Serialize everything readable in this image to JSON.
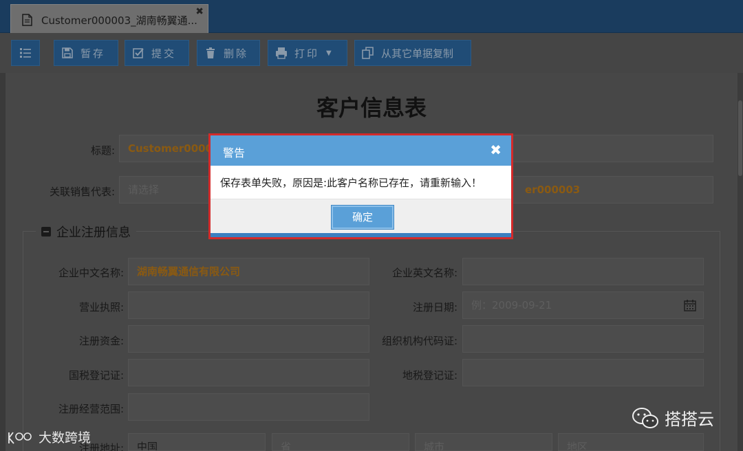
{
  "tab": {
    "label": "Customer000003_湖南畅翼通...",
    "close": "✖"
  },
  "toolbar": {
    "save": "暂存",
    "submit": "提交",
    "delete": "删除",
    "print": "打印",
    "copy": "从其它单据复制"
  },
  "form": {
    "title": "客户信息表",
    "title_label": "标题:",
    "title_value": "Customer00000",
    "sales_label": "关联销售代表:",
    "sales_placeholder": "请选择",
    "right_value": "er000003",
    "section_title": "企业注册信息",
    "fields": {
      "cn_name_label": "企业中文名称:",
      "cn_name_value": "湖南畅翼通信有限公司",
      "en_name_label": "企业英文名称:",
      "license_label": "营业执照:",
      "reg_date_label": "注册日期:",
      "reg_date_placeholder": "例：2009-09-21",
      "capital_label": "注册资金:",
      "org_code_label": "组织机构代码证:",
      "national_tax_label": "国税登记证:",
      "local_tax_label": "地税登记证:",
      "scope_label": "注册经营范围:",
      "country_value": "中国",
      "province_placeholder": "省",
      "city_placeholder": "城市",
      "district_placeholder": "地区",
      "address_label_partial": "注册地址:"
    }
  },
  "dialog": {
    "title": "警告",
    "close": "✖",
    "message": "保存表单失败，原因是:此客户名称已存在，请重新输入！",
    "ok": "确定"
  },
  "watermarks": {
    "left": "大数跨境",
    "right": "搭搭云"
  },
  "colors": {
    "accent": "#5aa0d8",
    "alert_border": "#d42a2a",
    "toolbar_button": "#204c76",
    "highlight_text": "#8a5a12"
  }
}
